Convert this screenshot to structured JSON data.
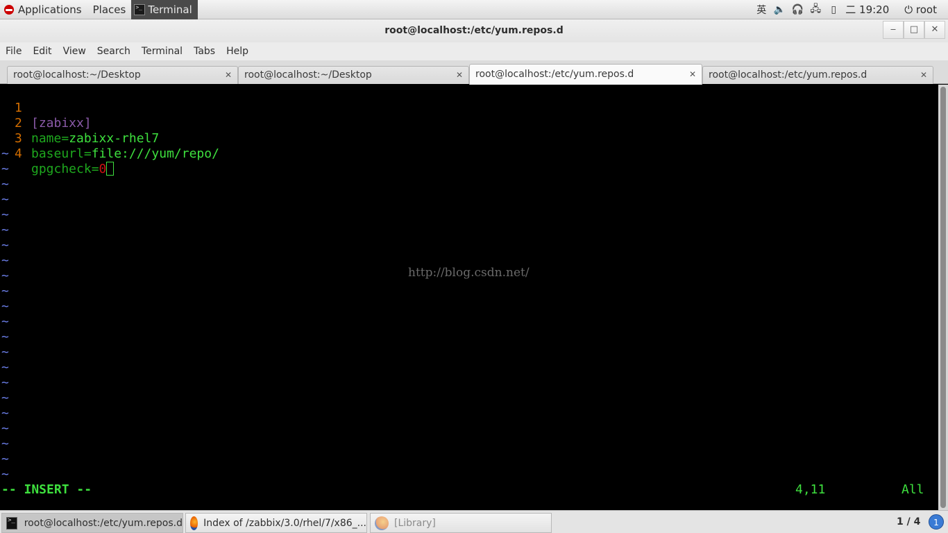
{
  "top_panel": {
    "applications": "Applications",
    "places": "Places",
    "terminal": "Terminal",
    "input_method": "英",
    "clock": "二 19:20",
    "user": "root"
  },
  "window": {
    "title": "root@localhost:/etc/yum.repos.d",
    "minimize": "‒",
    "maximize": "□",
    "close": "✕"
  },
  "menu": [
    "File",
    "Edit",
    "View",
    "Search",
    "Terminal",
    "Tabs",
    "Help"
  ],
  "tabs": [
    {
      "label": "root@localhost:~/Desktop",
      "active": false
    },
    {
      "label": "root@localhost:~/Desktop",
      "active": false
    },
    {
      "label": "root@localhost:/etc/yum.repos.d",
      "active": true
    },
    {
      "label": "root@localhost:/etc/yum.repos.d",
      "active": false
    }
  ],
  "editor": {
    "lines": [
      {
        "num": "1",
        "section": "[zabixx]"
      },
      {
        "num": "2",
        "key": "name=",
        "value": "zabixx-rhel7"
      },
      {
        "num": "3",
        "key": "baseurl=",
        "value": "file:///yum/repo/"
      },
      {
        "num": "4",
        "key": "gpgcheck=",
        "value": "0"
      }
    ],
    "tilde": "~",
    "mode": "-- INSERT --",
    "position": "4,11",
    "scroll": "All",
    "watermark": "http://blog.csdn.net/"
  },
  "taskbar": {
    "items": [
      {
        "label": "root@localhost:/etc/yum.repos.d",
        "active": true
      },
      {
        "label": "Index of /zabbix/3.0/rhel/7/x86_...",
        "active": false
      },
      {
        "label": "[Library]",
        "active": false
      }
    ],
    "workspace": "1 / 4",
    "notifications": "1"
  }
}
